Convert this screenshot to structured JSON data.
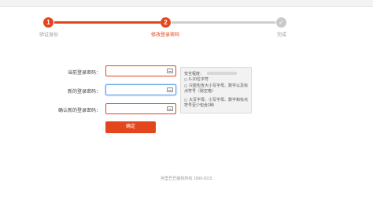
{
  "steps": [
    {
      "number": "1",
      "label": "验证身份",
      "state": "done"
    },
    {
      "number": "2",
      "label": "修改登录密码",
      "state": "current"
    },
    {
      "number": "✓",
      "label": "完成",
      "state": "todo"
    }
  ],
  "form": {
    "current_password_label": "当前登录密码：",
    "new_password_label": "新的登录密码：",
    "confirm_password_label": "确认新的登录密码：",
    "submit_label": "确定"
  },
  "tips": {
    "title": "安全程度：",
    "items": [
      "6-20位字符",
      "只能包含大小写字母、数字以及标点符号（除空格）",
      "大写字母、小写字母、数字和标点符号至少包含2种"
    ]
  },
  "footer": {
    "copyright": "阿里巴巴版权所有 1999-2015"
  },
  "colors": {
    "accent": "#e3461d",
    "inactive": "#c9c9c9",
    "focus_border": "#5aa0e6"
  }
}
